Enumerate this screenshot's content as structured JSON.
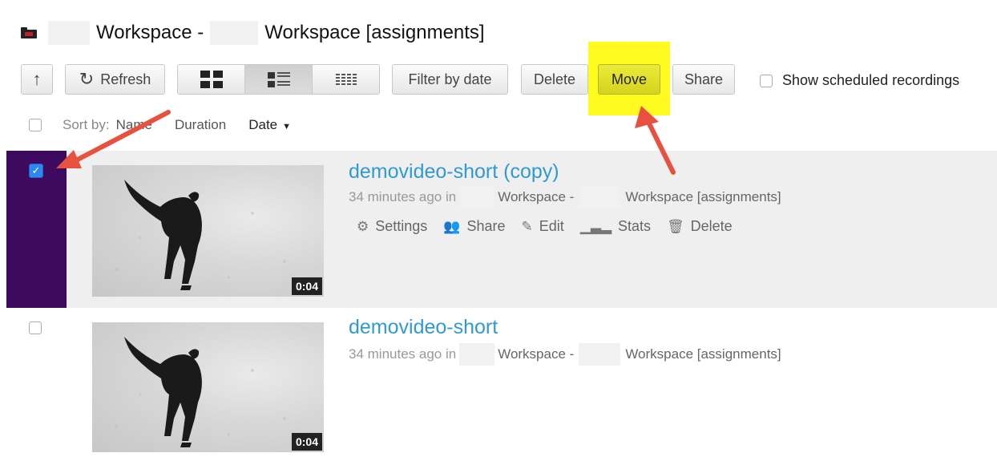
{
  "header": {
    "icon": "folder-icon",
    "title_part1": "Workspace -",
    "title_part2": "Workspace [assignments]"
  },
  "toolbar": {
    "up_label": "↑",
    "refresh_label": "Refresh",
    "filter_label": "Filter by date",
    "delete_label": "Delete",
    "move_label": "Move",
    "share_label": "Share",
    "scheduled_label": "Show scheduled recordings",
    "views": [
      "grid-view",
      "list-view",
      "dense-view"
    ],
    "active_view": "list-view",
    "highlight_color": "#fffa1f"
  },
  "sort": {
    "label": "Sort by:",
    "name": "Name",
    "duration": "Duration",
    "date": "Date",
    "caret": "▼"
  },
  "items": [
    {
      "title": "demovideo-short (copy)",
      "meta_prefix": "34 minutes ago in",
      "meta_ws1": "Workspace -",
      "meta_ws2": "Workspace [assignments]",
      "duration": "0:04",
      "selected": true,
      "actions": [
        "Settings",
        "Share",
        "Edit",
        "Stats",
        "Delete"
      ]
    },
    {
      "title": "demovideo-short",
      "meta_prefix": "34 minutes ago in",
      "meta_ws1": "Workspace -",
      "meta_ws2": "Workspace [assignments]",
      "duration": "0:04",
      "selected": false
    }
  ],
  "colors": {
    "selection_bar": "#3d0a5f",
    "title_link": "#2f9bd0",
    "arrow": "#e8503f"
  }
}
